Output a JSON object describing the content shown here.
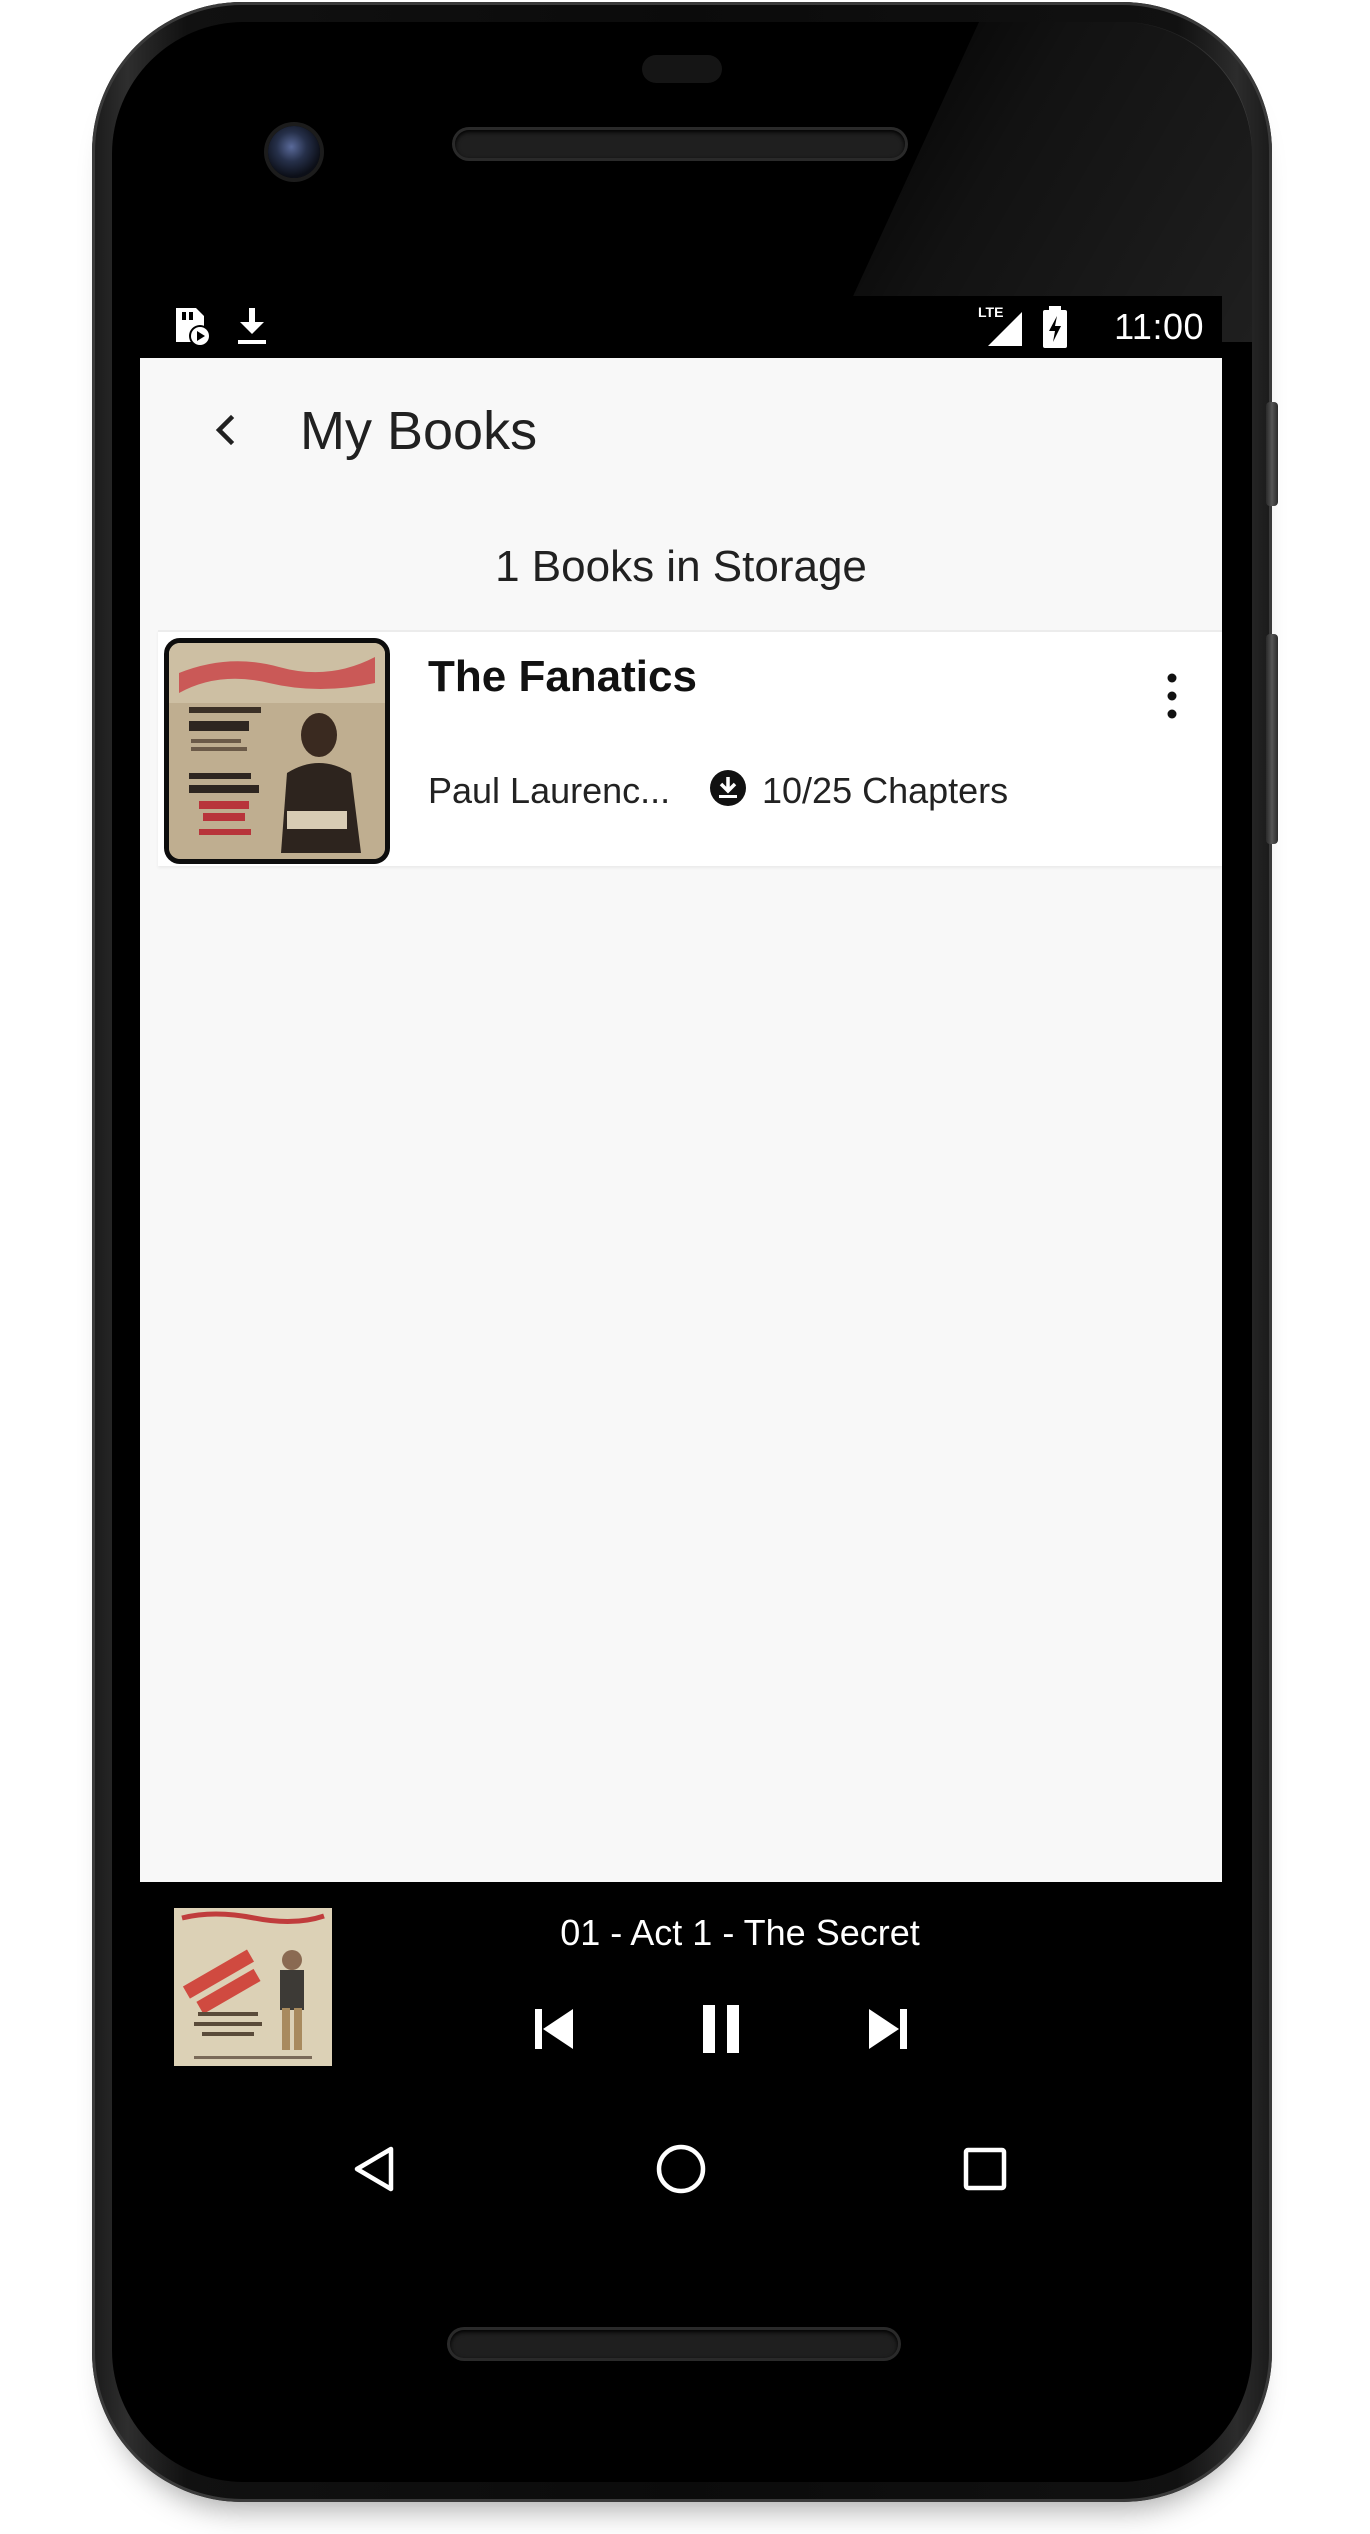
{
  "status_bar": {
    "time": "11:00",
    "network": "LTE",
    "left_icons": [
      "sd-card-play-icon",
      "download-icon"
    ],
    "right_icons": [
      "lte-signal-icon",
      "battery-charging-icon"
    ]
  },
  "toolbar": {
    "back_icon": "chevron-left-icon",
    "title": "My Books"
  },
  "library": {
    "count_text": "1 Books in Storage",
    "books": [
      {
        "title": "The Fanatics",
        "author": "Paul Laurenc...",
        "chapters": "10/25 Chapters",
        "download_icon": "download-circle-icon",
        "menu_icon": "more-vertical-icon"
      }
    ]
  },
  "player": {
    "track_title": "01 - Act 1 - The Secret",
    "controls": [
      "skip-previous-icon",
      "pause-icon",
      "skip-next-icon"
    ]
  },
  "nav": {
    "buttons": [
      "back-triangle-icon",
      "home-circle-icon",
      "recents-square-icon"
    ]
  },
  "colors": {
    "screen_bg": "#f8f8f8",
    "card_bg": "#ffffff",
    "player_bg": "#000000",
    "text_primary": "#212121",
    "device_body": "#0b0b0b"
  }
}
